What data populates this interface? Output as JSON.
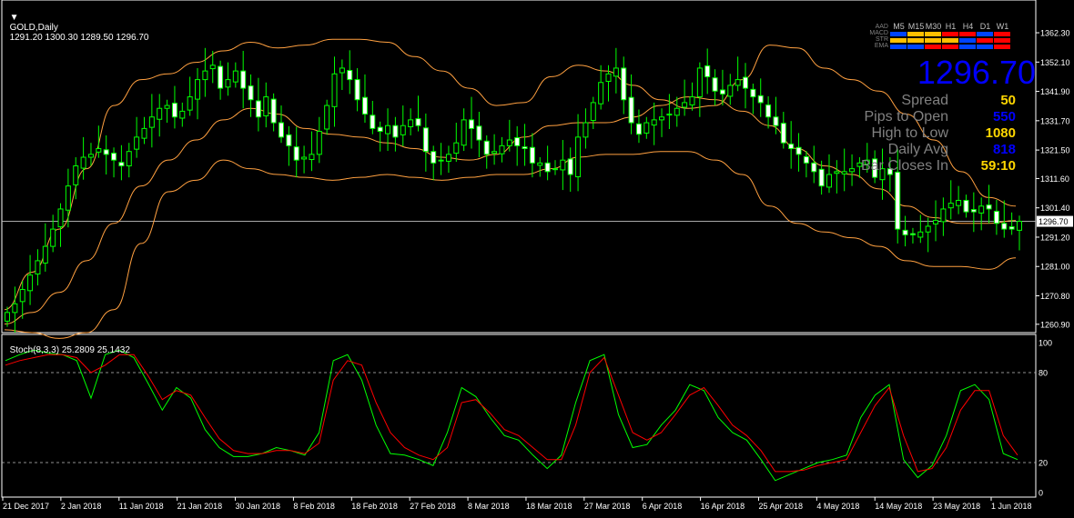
{
  "header": {
    "symbol": "GOLD,Daily",
    "ohlc": "1291.20 1300.30 1289.50 1296.70",
    "stoch_label": "Stoch(8,3,3) 25.2809 25.1432"
  },
  "colors": {
    "background": "#000000",
    "bull_candle": "#00ff00",
    "bands": "#ffa040",
    "stoch_main": "#00ff00",
    "stoch_signal": "#ff0000",
    "grid_text": "#ffffff",
    "big_price": "#0000ff",
    "panel_label": "#808080",
    "value_yellow": "#ffd700",
    "value_blue": "#0000ff"
  },
  "info_panel": {
    "timeframes": [
      "M5",
      "M15",
      "M30",
      "H1",
      "H4",
      "D1",
      "W1"
    ],
    "rows": [
      {
        "label": "AAD",
        "cells": [
          "none",
          "none",
          "none",
          "none",
          "none",
          "none",
          "none"
        ]
      },
      {
        "label": "MACD",
        "cells": [
          "blue",
          "gold",
          "gold",
          "red",
          "red",
          "blue",
          "red"
        ]
      },
      {
        "label": "STR",
        "cells": [
          "gold",
          "gold",
          "gold",
          "gold",
          "blue",
          "red",
          "red"
        ]
      },
      {
        "label": "EMA",
        "cells": [
          "blue",
          "blue",
          "red",
          "red",
          "blue",
          "blue",
          "red"
        ]
      }
    ],
    "big_price": "1296.70",
    "stats": [
      {
        "label": "Spread",
        "value": "50",
        "color": "gold"
      },
      {
        "label": "Pips to Open",
        "value": "550",
        "color": "blue"
      },
      {
        "label": "High to Low",
        "value": "1080",
        "color": "gold"
      },
      {
        "label": "Daily Avg",
        "value": "818",
        "color": "blue"
      },
      {
        "label": "Bar Closes In",
        "value": "59:10",
        "color": "gold"
      }
    ]
  },
  "chart_data": [
    {
      "type": "candlestick",
      "title": "GOLD,Daily",
      "ylim": [
        1258.0,
        1368.0
      ],
      "y_ticks": [
        "1362.30",
        "1352.10",
        "1341.90",
        "1331.70",
        "1321.50",
        "1311.60",
        "1301.40",
        "1291.20",
        "1281.00",
        "1270.80",
        "1260.90"
      ],
      "y_tick_values": [
        1362.3,
        1352.1,
        1341.9,
        1331.7,
        1321.5,
        1311.6,
        1301.4,
        1291.2,
        1281.0,
        1270.8,
        1260.9
      ],
      "current_price": 1296.7,
      "current_price_label": "1296.70",
      "x_ticks": [
        "21 Dec 2017",
        "2 Jan 2018",
        "11 Jan 2018",
        "21 Jan 2018",
        "30 Jan 2018",
        "8 Feb 2018",
        "18 Feb 2018",
        "27 Feb 2018",
        "8 Mar 2018",
        "18 Mar 2018",
        "27 Mar 2018",
        "6 Apr 2018",
        "16 Apr 2018",
        "25 Apr 2018",
        "4 May 2018",
        "14 May 2018",
        "23 May 2018",
        "1 Jun 2018"
      ],
      "closes": [
        1265,
        1268,
        1273,
        1278,
        1283,
        1288,
        1294,
        1301,
        1309,
        1316,
        1319,
        1320,
        1322,
        1320,
        1318,
        1316,
        1321,
        1326,
        1329,
        1333,
        1336,
        1337,
        1333,
        1335,
        1340,
        1346,
        1349,
        1351,
        1343,
        1346,
        1349,
        1343,
        1339,
        1333,
        1340,
        1331,
        1326,
        1323,
        1318,
        1319,
        1320,
        1328,
        1337,
        1348,
        1350,
        1346,
        1339,
        1334,
        1329,
        1328,
        1330,
        1326,
        1330,
        1332,
        1330,
        1321,
        1317,
        1318,
        1320,
        1324,
        1332,
        1329,
        1325,
        1320,
        1321,
        1323,
        1325,
        1323,
        1322,
        1317,
        1317,
        1314,
        1315,
        1318,
        1313,
        1326,
        1331,
        1338,
        1345,
        1348,
        1350,
        1339,
        1331,
        1327,
        1331,
        1332,
        1333,
        1334,
        1336,
        1338,
        1340,
        1350,
        1347,
        1342,
        1341,
        1344,
        1346,
        1343,
        1340,
        1338,
        1333,
        1330,
        1324,
        1322,
        1320,
        1317,
        1314,
        1309,
        1313,
        1314,
        1314,
        1315,
        1317,
        1318,
        1312,
        1315,
        1313,
        1294,
        1292,
        1292,
        1293,
        1295,
        1297,
        1301,
        1303,
        1304,
        1300,
        1300,
        1302,
        1301,
        1296,
        1294,
        1294,
        1296.7
      ],
      "bollinger": {
        "upper": [
          1266,
          1279,
          1294,
          1315,
          1337,
          1346,
          1348,
          1352,
          1356,
          1359,
          1357,
          1358,
          1360,
          1360,
          1359,
          1354,
          1349,
          1343,
          1337,
          1338,
          1347,
          1351,
          1349,
          1344,
          1339,
          1336,
          1337,
          1346,
          1358,
          1357,
          1350,
          1346,
          1342,
          1334,
          1325,
          1314,
          1305,
          1302
        ],
        "middle": [
          1261,
          1265,
          1272,
          1283,
          1296,
          1309,
          1318,
          1325,
          1332,
          1336,
          1334,
          1329,
          1327,
          1326,
          1324,
          1322,
          1319,
          1318,
          1320,
          1326,
          1330,
          1331,
          1331,
          1333,
          1337,
          1340,
          1339,
          1335,
          1330,
          1322,
          1316,
          1313,
          1308,
          1302,
          1298,
          1296,
          1296,
          1297
        ],
        "lower": [
          1259,
          1258,
          1256,
          1258,
          1266,
          1289,
          1307,
          1311,
          1318,
          1315,
          1313,
          1312,
          1311,
          1312,
          1313,
          1312,
          1311,
          1312,
          1313,
          1313,
          1315,
          1319,
          1320,
          1320,
          1321,
          1321,
          1318,
          1313,
          1302,
          1296,
          1293,
          1291,
          1288,
          1283,
          1281,
          1281,
          1280,
          1284
        ]
      }
    },
    {
      "type": "line",
      "title": "Stoch(8,3,3) 25.2809 25.1432",
      "ylim": [
        0,
        100
      ],
      "y_ticks": [
        "100",
        "80",
        "20",
        "0"
      ],
      "y_tick_values": [
        100,
        80,
        20,
        0
      ],
      "levels": [
        80,
        20
      ],
      "series": [
        {
          "values": [
            88,
            92,
            95,
            93,
            92,
            88,
            63,
            92,
            95,
            90,
            73,
            55,
            70,
            63,
            42,
            30,
            24,
            24,
            26,
            30,
            28,
            25,
            40,
            88,
            92,
            75,
            45,
            26,
            25,
            22,
            18,
            40,
            70,
            64,
            50,
            38,
            35,
            25,
            16,
            25,
            60,
            88,
            92,
            52,
            30,
            32,
            45,
            55,
            72,
            68,
            50,
            40,
            35,
            22,
            8,
            12,
            16,
            20,
            22,
            25,
            50,
            65,
            72,
            22,
            10,
            18,
            38,
            68,
            72,
            62,
            26,
            22
          ]
        },
        {
          "values": [
            85,
            88,
            90,
            92,
            92,
            90,
            80,
            85,
            92,
            92,
            78,
            62,
            68,
            65,
            50,
            36,
            28,
            26,
            26,
            28,
            28,
            26,
            33,
            75,
            88,
            85,
            60,
            40,
            30,
            25,
            22,
            30,
            60,
            62,
            53,
            42,
            38,
            30,
            22,
            22,
            45,
            80,
            90,
            65,
            40,
            35,
            40,
            52,
            65,
            70,
            58,
            45,
            38,
            28,
            14,
            14,
            15,
            18,
            20,
            22,
            40,
            58,
            70,
            38,
            14,
            16,
            30,
            55,
            68,
            68,
            38,
            25
          ]
        }
      ]
    }
  ]
}
